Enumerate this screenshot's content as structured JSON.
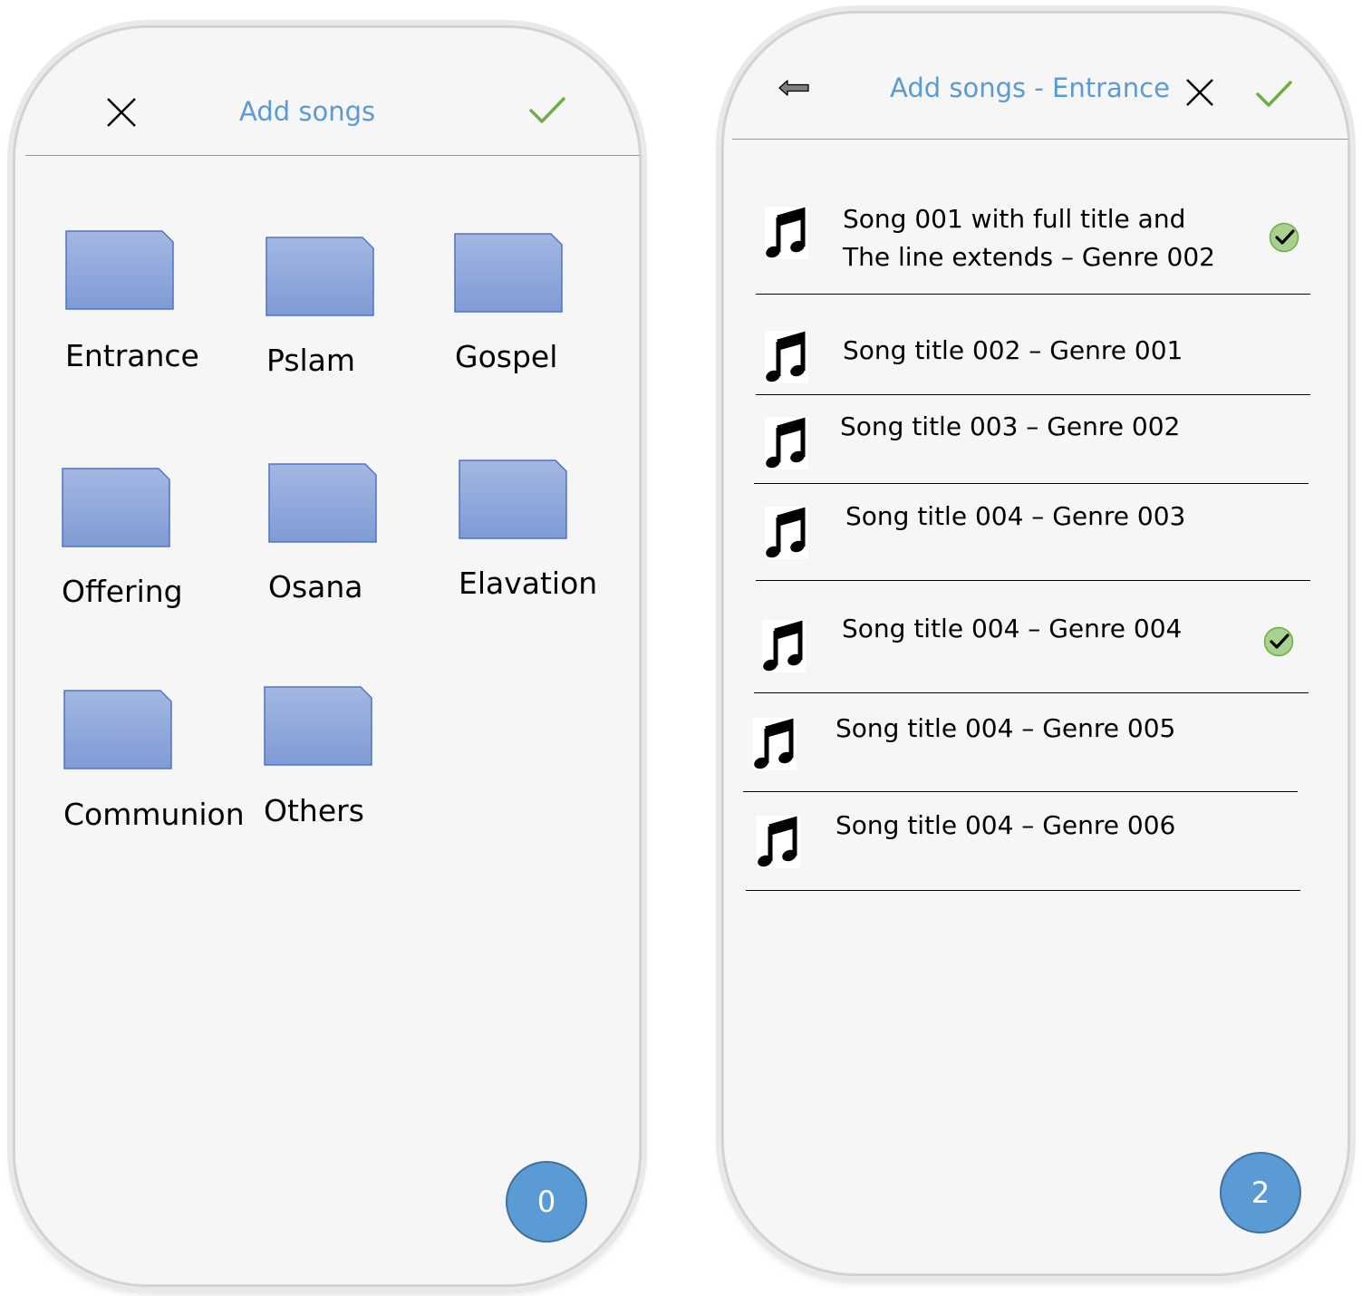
{
  "left_screen": {
    "header": {
      "title": "Add songs"
    },
    "categories": [
      {
        "label": "Entrance"
      },
      {
        "label": "Pslam"
      },
      {
        "label": "Gospel"
      },
      {
        "label": "Offering"
      },
      {
        "label": "Osana"
      },
      {
        "label": "Elavation"
      },
      {
        "label": "Communion"
      },
      {
        "label": "Others"
      }
    ],
    "selected_count": "0"
  },
  "right_screen": {
    "header": {
      "title": "Add songs - Entrance"
    },
    "songs": [
      {
        "line1": "Song 001 with full title and",
        "line2": "The line extends – Genre 002",
        "selected": true
      },
      {
        "line1": "Song title 002 – Genre 001",
        "line2": "",
        "selected": false
      },
      {
        "line1": "Song title 003 – Genre 002",
        "line2": "",
        "selected": false
      },
      {
        "line1": "Song title 004 – Genre 003",
        "line2": "",
        "selected": false
      },
      {
        "line1": "Song title 004 – Genre 004",
        "line2": "",
        "selected": true
      },
      {
        "line1": "Song title 004 – Genre 005",
        "line2": "",
        "selected": false
      },
      {
        "line1": "Song title 004 – Genre 006",
        "line2": "",
        "selected": false
      }
    ],
    "selected_count": "2"
  },
  "icons": {
    "close": "close-icon",
    "confirm": "checkmark-icon",
    "back": "back-arrow-icon",
    "folder": "folder-icon",
    "song": "music-note-icon",
    "selected": "selected-check-icon"
  },
  "colors": {
    "accent_blue": "#5b9bd5",
    "confirm_green": "#70ad47",
    "folder_fill": "#8faadc",
    "check_badge_fill": "#a9d18e",
    "fab_fill": "#5b9bd5"
  }
}
